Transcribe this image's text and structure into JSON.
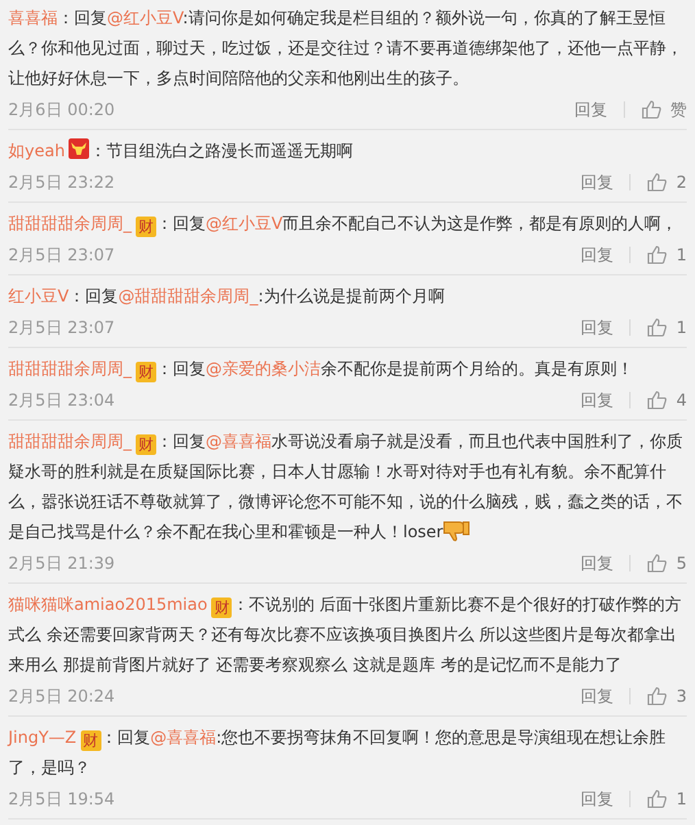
{
  "comments": [
    {
      "user": "喜喜福",
      "reply_label": "：回复",
      "mention": "@红小豆V",
      "text": ":请问你是如何确定我是栏目组的？额外说一句，你真的了解王昱恒么？你和他见过面，聊过天，吃过饭，还是交往过？请不要再道德绑架他了，还他一点平静，让他好好休息一下，多点时间陪陪他的父亲和他刚出生的孩子。",
      "emoji": false,
      "time": "2月6日 00:20",
      "reply_button": "回复",
      "likes": "赞"
    },
    {
      "user": "如yeah",
      "badge": {
        "kind": "vip"
      },
      "reply_label": "：",
      "text": "节目组洗白之路漫长而遥遥无期啊",
      "emoji": false,
      "time": "2月5日 23:22",
      "reply_button": "回复",
      "likes": "2"
    },
    {
      "user": "甜甜甜甜余周周_",
      "badge": {
        "kind": "cai",
        "text": "财"
      },
      "reply_label": "：回复",
      "mention": "@红小豆V",
      "text": "而且余不配自己不认为这是作弊，都是有原则的人啊，",
      "emoji": false,
      "time": "2月5日 23:07",
      "reply_button": "回复",
      "likes": "1"
    },
    {
      "user": "红小豆V",
      "reply_label": "：回复",
      "mention": "@甜甜甜甜余周周_",
      "text": ":为什么说是提前两个月啊",
      "emoji": false,
      "time": "2月5日 23:07",
      "reply_button": "回复",
      "likes": "1"
    },
    {
      "user": "甜甜甜甜余周周_",
      "badge": {
        "kind": "cai",
        "text": "财"
      },
      "reply_label": "：回复",
      "mention": "@亲爱的桑小洁",
      "text": "余不配你是提前两个月给的。真是有原则！",
      "emoji": false,
      "time": "2月5日 23:04",
      "reply_button": "回复",
      "likes": "4"
    },
    {
      "user": "甜甜甜甜余周周_",
      "badge": {
        "kind": "cai",
        "text": "财"
      },
      "reply_label": "：回复",
      "mention": "@喜喜福",
      "text": "水哥说没看扇子就是没看，而且也代表中国胜利了，你质疑水哥的胜利就是在质疑国际比赛，日本人甘愿输！水哥对待对手也有礼有貌。余不配算什么，嚣张说狂话不尊敬就算了，微博评论您不可能不知，说的什么脑残，贱，蠢之类的话，不是自己找骂是什么？余不配在我心里和霍顿是一种人！loser",
      "emoji": true,
      "time": "2月5日 21:39",
      "reply_button": "回复",
      "likes": "5"
    },
    {
      "user": "猫咪猫咪amiao2015miao",
      "badge": {
        "kind": "cai",
        "text": "财"
      },
      "reply_label": "：",
      "text": "不说别的 后面十张图片重新比赛不是个很好的打破作弊的方式么 余还需要回家背两天？还有每次比赛不应该换项目换图片么 所以这些图片是每次都拿出来用么 那提前背图片就好了 还需要考察观察么 这就是题库 考的是记忆而不是能力了",
      "emoji": false,
      "time": "2月5日 20:24",
      "reply_button": "回复",
      "likes": "3"
    },
    {
      "user": "JingY—Z",
      "badge": {
        "kind": "cai",
        "text": "财"
      },
      "reply_label": "：回复",
      "mention": "@喜喜福",
      "text": ":您也不要拐弯抹角不回复啊！您的意思是导演组现在想让余胜了，是吗？",
      "emoji": false,
      "time": "2月5日 19:54",
      "reply_button": "回复",
      "likes": "1"
    }
  ]
}
